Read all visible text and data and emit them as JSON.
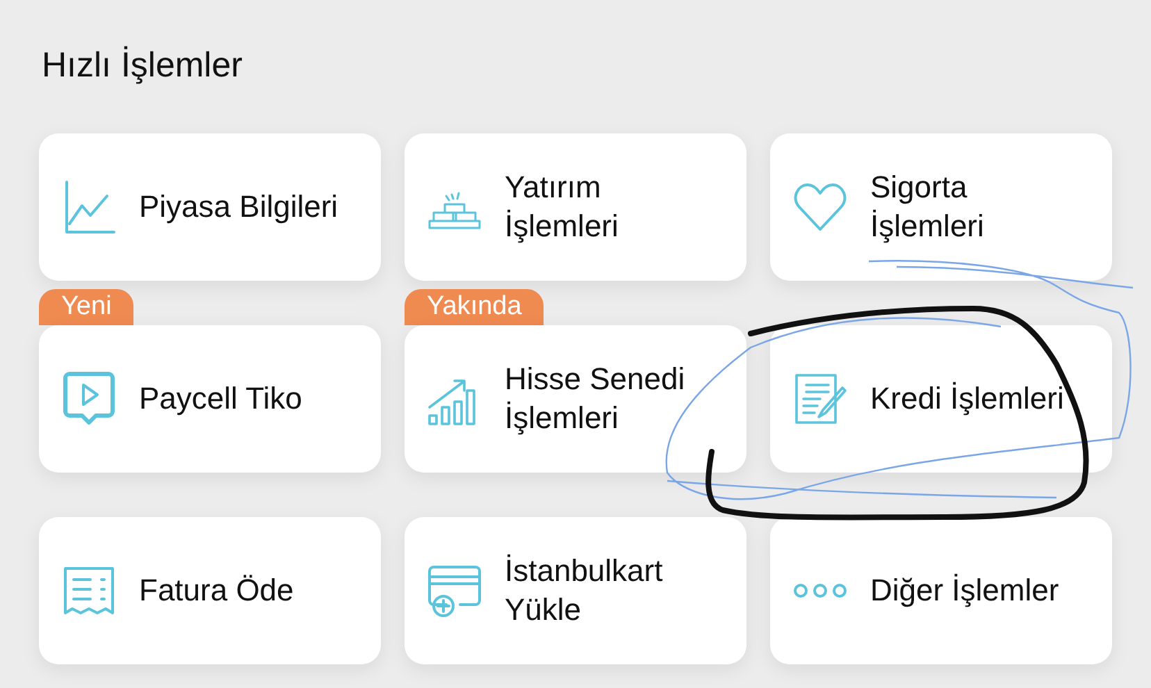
{
  "title": "Hızlı İşlemler",
  "items": [
    {
      "lines": [
        "Piyasa Bilgileri"
      ],
      "kind": "chart"
    },
    {
      "lines": [
        "Yatırım",
        "İşlemleri"
      ],
      "kind": "gold"
    },
    {
      "lines": [
        "Sigorta",
        "İşlemleri"
      ],
      "kind": "heart"
    },
    {
      "lines": [
        "Paycell Tiko"
      ],
      "kind": "play",
      "badge": "Yeni"
    },
    {
      "lines": [
        "Hisse Senedi",
        "İşlemleri"
      ],
      "kind": "growth",
      "badge": "Yakında"
    },
    {
      "lines": [
        "Kredi İşlemleri"
      ],
      "kind": "document"
    },
    {
      "lines": [
        "Fatura Öde"
      ],
      "kind": "receipt"
    },
    {
      "lines": [
        "İstanbulkart",
        "Yükle"
      ],
      "kind": "card"
    },
    {
      "lines": [
        "Diğer İşlemler"
      ],
      "kind": "dots"
    }
  ]
}
